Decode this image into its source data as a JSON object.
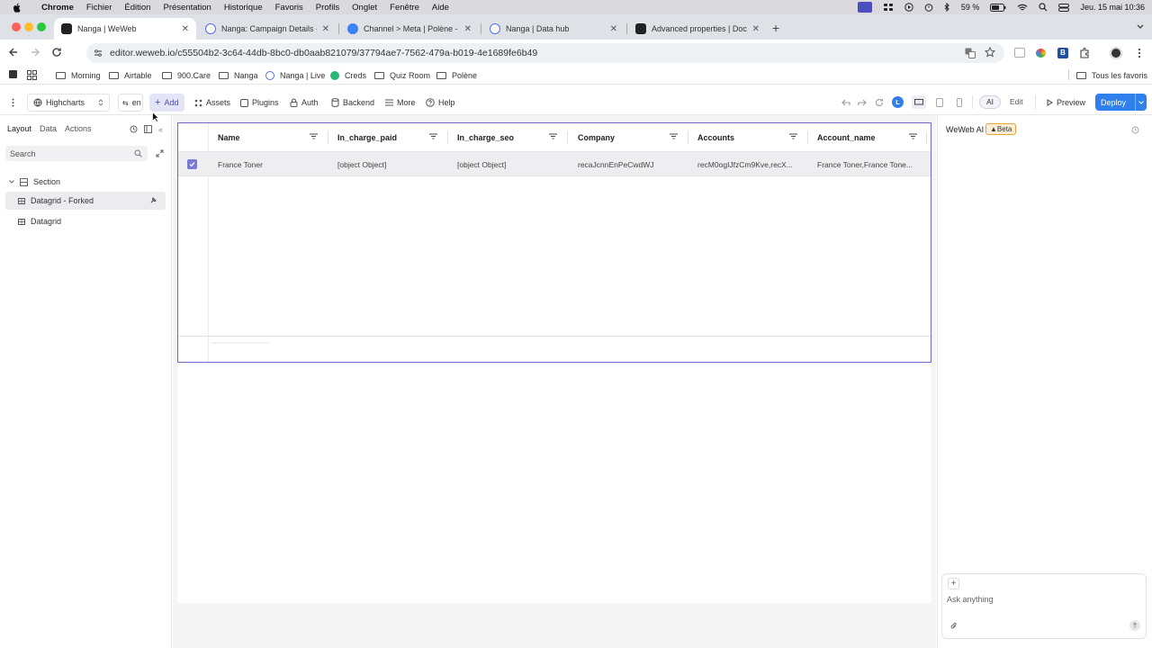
{
  "menubar": {
    "app": "Chrome",
    "items": [
      "Fichier",
      "Édition",
      "Présentation",
      "Historique",
      "Favoris",
      "Profils",
      "Onglet",
      "Fenêtre",
      "Aide"
    ],
    "battery": "59 %",
    "clock": "Jeu. 15 mai  10:36"
  },
  "tabs": [
    {
      "label": "Nanga | WeWeb",
      "active": true
    },
    {
      "label": "Nanga: Campaign Details - A"
    },
    {
      "label": "Channel > Meta | Polène - Da"
    },
    {
      "label": "Nanga | Data hub"
    },
    {
      "label": "Advanced properties | Docum"
    }
  ],
  "address": {
    "url": "editor.weweb.io/c55504b2-3c64-44db-8bc0-db0aab821079/37794ae7-7562-479a-b019-4e1689fe6b49"
  },
  "bookmarks": {
    "items": [
      "Morning",
      "Airtable",
      "900.Care",
      "Nanga",
      "Nanga | Live",
      "Creds",
      "Quiz Room",
      "Polène"
    ],
    "all": "Tous les favoris"
  },
  "editor": {
    "page_select": "Highcharts",
    "lang": "en",
    "add": "Add",
    "assets": "Assets",
    "plugins": "Plugins",
    "auth": "Auth",
    "backend": "Backend",
    "more": "More",
    "help": "Help",
    "avatar": "L",
    "ai": "AI",
    "edit": "Edit",
    "preview": "Preview",
    "deploy": "Deploy"
  },
  "left_panel": {
    "tabs": [
      "Layout",
      "Data",
      "Actions"
    ],
    "search_placeholder": "Search",
    "tree": [
      {
        "label": "Section"
      },
      {
        "label": "Datagrid - Forked"
      },
      {
        "label": "Datagrid"
      }
    ]
  },
  "datagrid": {
    "columns": [
      "Name",
      "In_charge_paid",
      "In_charge_seo",
      "Company",
      "Accounts",
      "Account_name"
    ],
    "rows": [
      [
        "France Toner",
        "[object Object]",
        "[object Object]",
        "recaJcnnEnPeCwdWJ",
        "recM0ogIJfzCm9Kve,recX...",
        "France Toner,France Tone..."
      ]
    ]
  },
  "right_panel": {
    "title": "WeWeb AI",
    "badge": "Beta",
    "ask_placeholder": "Ask anything"
  },
  "colors": {
    "accent": "#6d6bd1",
    "deploy": "#2f80ed",
    "beta_bg": "#fdeed6",
    "beta_border": "#e9a33a"
  }
}
